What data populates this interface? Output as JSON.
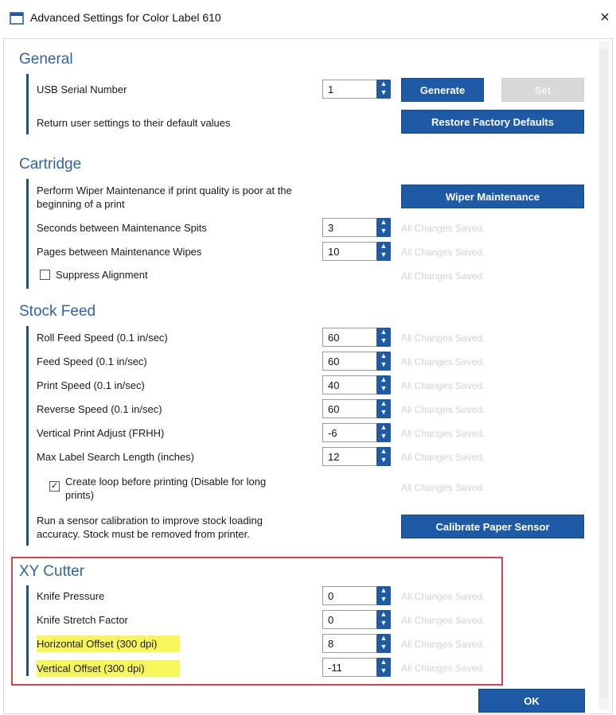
{
  "window": {
    "title": "Advanced Settings for Color Label 610",
    "close": "×"
  },
  "icons": {
    "app": "window-icon",
    "close": "close-icon",
    "spin": "spin-arrows-icon",
    "check": "checkmark-icon"
  },
  "general": {
    "title": "General",
    "usb_label": "USB Serial Number",
    "usb_value": "1",
    "generate_label": "Generate",
    "set_label": "Set",
    "restore_text": "Return user settings to their default values",
    "restore_label": "Restore Factory Defaults"
  },
  "cartridge": {
    "title": "Cartridge",
    "wiper_text": "Perform Wiper Maintenance if print quality is poor at the beginning of a print",
    "wiper_label": "Wiper Maintenance",
    "spits_label": "Seconds between Maintenance Spits",
    "spits_value": "3",
    "wipes_label": "Pages between Maintenance Wipes",
    "wipes_value": "10",
    "suppress_label": "Suppress Alignment",
    "suppress_checked": false
  },
  "stock_feed": {
    "title": "Stock Feed",
    "rows": [
      {
        "label": "Roll Feed Speed (0.1 in/sec)",
        "value": "60"
      },
      {
        "label": "Feed Speed (0.1 in/sec)",
        "value": "60"
      },
      {
        "label": "Print Speed (0.1 in/sec)",
        "value": "40"
      },
      {
        "label": "Reverse Speed (0.1 in/sec)",
        "value": "60"
      },
      {
        "label": "Vertical Print Adjust (FRHH)",
        "value": "-6"
      },
      {
        "label": "Max Label Search Length (inches)",
        "value": "12"
      }
    ],
    "loop_label": "Create loop before printing (Disable for long prints)",
    "loop_checked": true,
    "calibrate_text": "Run a sensor calibration to improve stock loading accuracy. Stock must be removed from printer.",
    "calibrate_label": "Calibrate Paper Sensor"
  },
  "xy_cutter": {
    "title": "XY Cutter",
    "rows": [
      {
        "label": "Knife Pressure",
        "value": "0"
      },
      {
        "label": "Knife Stretch Factor",
        "value": "0"
      },
      {
        "label": "Horizontal Offset (300 dpi)",
        "value": "8"
      },
      {
        "label": "Vertical Offset (300 dpi)",
        "value": "-11"
      }
    ]
  },
  "saved_text": "All Changes Saved.",
  "ok_label": "OK",
  "colors": {
    "accent": "#1f5aa6",
    "section": "#2f63a8",
    "highlight": "#f8f75a",
    "callout": "#d9434a"
  }
}
